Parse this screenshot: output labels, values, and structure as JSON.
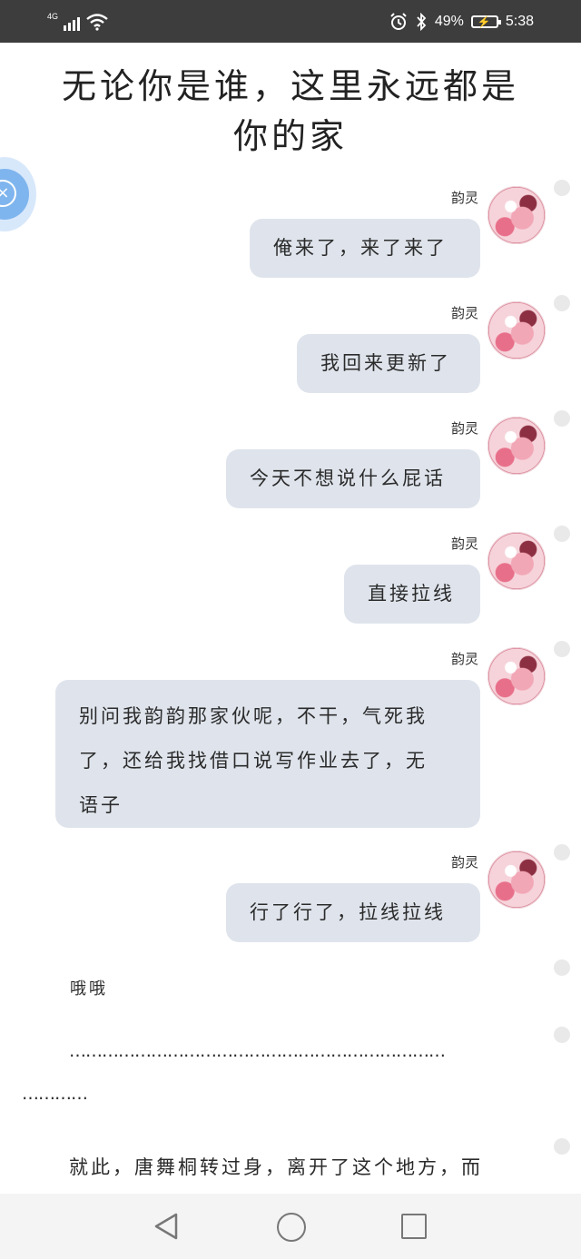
{
  "status_bar": {
    "network": "4G",
    "battery_percent": "49%",
    "time": "5:38"
  },
  "title": "无论你是谁，这里永远都是你的家",
  "messages": [
    {
      "sender": "韵灵",
      "text": "俺来了，来了来了"
    },
    {
      "sender": "韵灵",
      "text": "我回来更新了"
    },
    {
      "sender": "韵灵",
      "text": "今天不想说什么屁话"
    },
    {
      "sender": "韵灵",
      "text": "直接拉线"
    },
    {
      "sender": "韵灵",
      "lines": [
        "别问我韵韵那家伙呢，不干，气死我",
        "了，还给我找借口说写作业去了，无",
        "语子"
      ]
    },
    {
      "sender": "韵灵",
      "text": "行了行了，拉线拉线"
    }
  ],
  "plain_text": {
    "ohoh": "哦哦",
    "dots_line1": "……………………………………………………………",
    "dots_line2": "…………",
    "story": "就此，唐舞桐转过身，离开了这个地方，而"
  },
  "icons": {
    "float_button": "close-circle-icon",
    "nav_back": "back-triangle-icon",
    "nav_home": "home-circle-icon",
    "nav_recent": "recent-square-icon"
  }
}
